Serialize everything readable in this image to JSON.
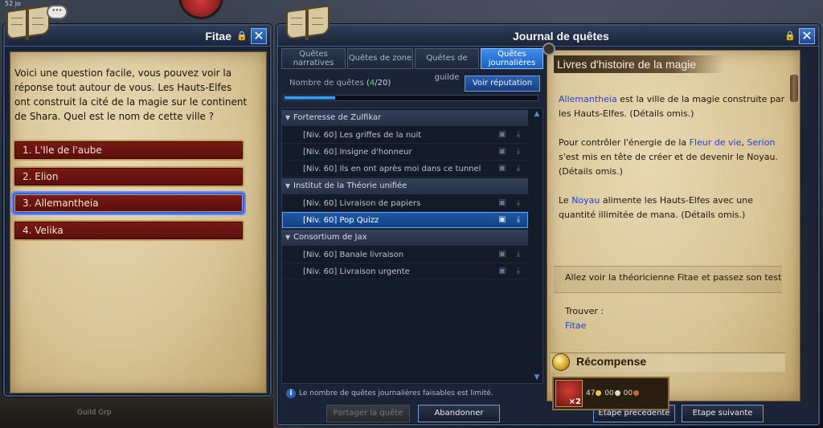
{
  "corner_tag": "52 jo",
  "fitae": {
    "title": "Fitae",
    "close_label": "✕",
    "question": "Voici une question facile, vous pouvez voir la réponse tout autour de vous. Les Hauts-Elfes ont construit la cité de la magie sur le continent de Shara. Quel est le nom de cette ville ?",
    "answers": [
      "1. L'Ile de l'aube",
      "2. Elion",
      "3. Allemantheia",
      "4. Velika"
    ],
    "selected_answer": 2
  },
  "journal": {
    "title": "Journal de quêtes",
    "close_label": "✕",
    "tabs": [
      {
        "line1": "Quêtes",
        "line2": "narratives"
      },
      {
        "line1": "Quêtes de zone",
        "line2": ""
      },
      {
        "line1": "Quêtes de guilde",
        "line2": ""
      },
      {
        "line1": "Quêtes",
        "line2": "journalières"
      }
    ],
    "active_tab": 3,
    "count_label": "Nombre de quêtes",
    "count_open": "(",
    "count_current": "4",
    "count_rest": "/20)",
    "progress_fraction": 0.2,
    "reputation_button": "Voir réputation",
    "groups": [
      {
        "name": "Forteresse de Zulfikar",
        "quests": [
          "[Niv. 60] Les griffes de la nuit",
          "[Niv. 60] Insigne d'honneur",
          "[Niv. 60] Ils en ont après moi dans ce tunnel"
        ]
      },
      {
        "name": "Institut de la Théorie unifiée",
        "quests": [
          "[Niv. 60] Livraison de papiers",
          "[Niv. 60] Pop Quizz"
        ]
      },
      {
        "name": "Consortium de Jax",
        "quests": [
          "[Niv. 60] Banale livraison",
          "[Niv. 60] Livraison urgente"
        ]
      }
    ],
    "selected_quest": "[Niv. 60] Pop Quizz",
    "note": "Le nombre de quêtes journalières faisables est limité.",
    "share_button": "Partager la quête",
    "abandon_button": "Abandonner",
    "prev_button": "Etape précédente",
    "next_button": "Etape suivante"
  },
  "detail": {
    "title": "Livres d'histoire de la magie",
    "p1_hl": "Allemantheia",
    "p1_rest": " est la ville de la magie construite par les Hauts-Elfes. (Détails omis.)",
    "p2_a": "Pour contrôler l'énergie de la ",
    "p2_hl1": "Fleur de vie",
    "p2_b": ", ",
    "p2_hl2": "Serion",
    "p2_c": " s'est mis en tête de créer et de devenir le Noyau. (Détails omis.)",
    "p3_a": "Le ",
    "p3_hl": "Noyau",
    "p3_b": " alimente les Hauts-Elfes avec une quantité illimitée de mana. (Détails omis.)",
    "task": "Allez voir la théoricienne Fitae et passez son test",
    "find_label": "Trouver :",
    "find_value": "Fitae",
    "reward_label": "Récompense",
    "reward_qty": "×2",
    "gold": "47",
    "silver": "00",
    "bronze": "00"
  },
  "bottom_text": [
    "Guild Grp",
    "Récompense"
  ]
}
